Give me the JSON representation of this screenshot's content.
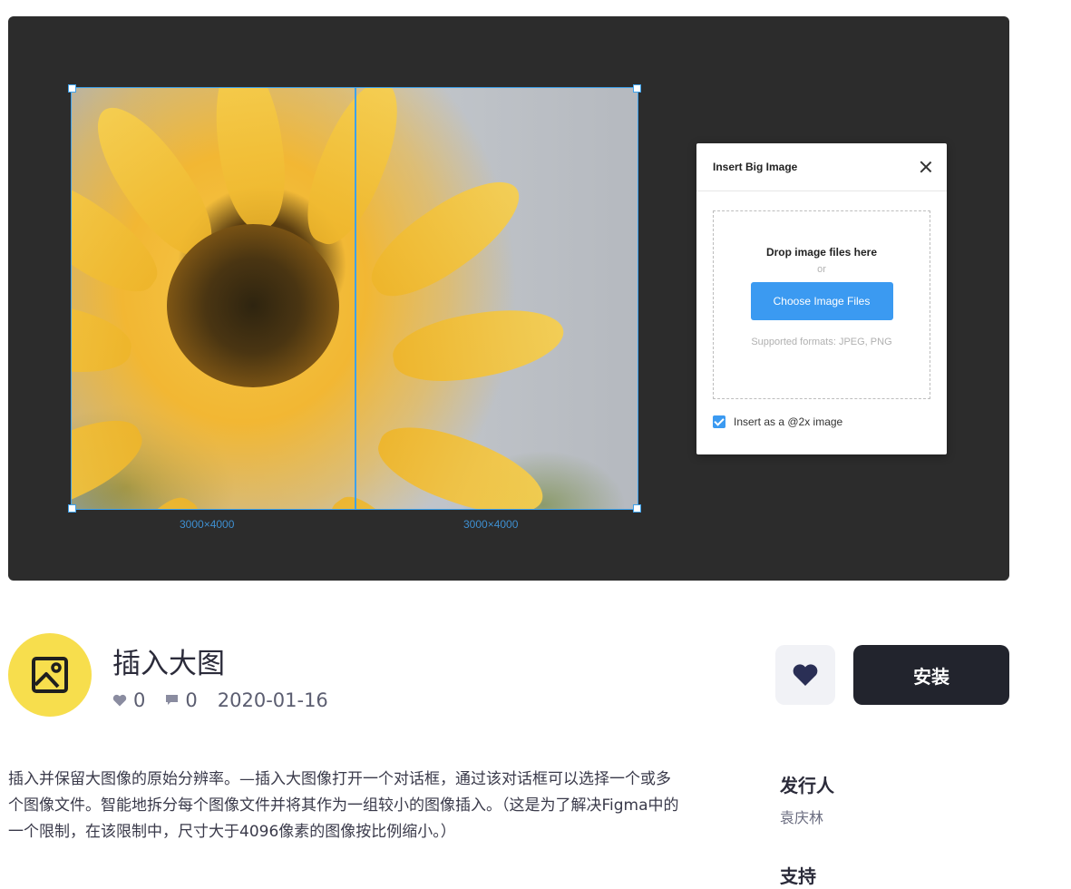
{
  "dialog": {
    "title": "Insert Big Image",
    "drop_title": "Drop image files here",
    "drop_or": "or",
    "choose_button": "Choose Image Files",
    "formats": "Supported formats: JPEG, PNG",
    "checkbox_label": "Insert as a @2x image",
    "checkbox_checked": true,
    "accent_color": "#3b9af1"
  },
  "canvas": {
    "left_dimension": "3000×4000",
    "right_dimension": "3000×4000",
    "selection_color": "#3ea1ea"
  },
  "plugin": {
    "title": "插入大图",
    "likes": "0",
    "comments": "0",
    "date": "2020-01-16",
    "icon": "image-icon",
    "icon_bg": "#f7de4d",
    "install_label": "安装",
    "description": "插入并保留大图像的原始分辨率。—插入大图像打开一个对话框，通过该对话框可以选择一个或多个图像文件。智能地拆分每个图像文件并将其作为一组较小的图像插入。（这是为了解决Figma中的一个限制，在该限制中，尺寸大于4096像素的图像按比例缩小。）"
  },
  "sidebar": {
    "publisher_label": "发行人",
    "publisher_name": "袁庆林",
    "support_label": "支持"
  }
}
